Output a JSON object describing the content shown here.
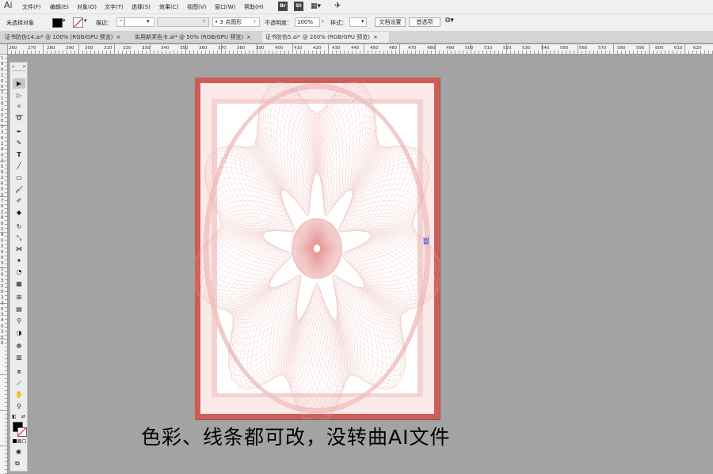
{
  "app": {
    "logo": "Ai",
    "menu": [
      "文件(F)",
      "编辑(E)",
      "对象(O)",
      "文字(T)",
      "选择(S)",
      "效果(C)",
      "视图(V)",
      "窗口(W)",
      "帮助(H)"
    ],
    "bridge_icon": "Br",
    "stock_icon": "St"
  },
  "control_bar": {
    "selection_status": "未选择对象",
    "stroke_label": "描边：",
    "brush_value": "3 点圆形",
    "opacity_label": "不透明度：",
    "opacity_value": "100%",
    "style_label": "样式：",
    "doc_setup_button": "文档设置",
    "preferences_button": "首选项"
  },
  "tabs": [
    {
      "label": "证书防伪14.ai* @ 100% (RGB/GPU 预览)",
      "close": "×",
      "active": false
    },
    {
      "label": "实用新奖色卡.ai* @ 50% (RGB/GPU 预览)",
      "close": "×",
      "active": false
    },
    {
      "label": "证书防伪5.ai* @ 200% (RGB/GPU 预览)",
      "close": "×",
      "active": true
    }
  ],
  "ruler": {
    "h_labels": [
      "260",
      "270",
      "280",
      "290",
      "300",
      "310",
      "320",
      "330",
      "340",
      "350",
      "360",
      "370",
      "380",
      "390",
      "400",
      "410",
      "420",
      "430",
      "440",
      "450",
      "460",
      "470",
      "480",
      "490",
      "500",
      "510",
      "520",
      "530",
      "540",
      "550",
      "560",
      "570",
      "580",
      "590",
      "600",
      "610",
      "620"
    ],
    "v_labels": [
      "1",
      "9",
      "0",
      "2",
      "0",
      "0",
      "2",
      "1",
      "0",
      "2",
      "2",
      "0",
      "2",
      "3",
      "0",
      "2",
      "4",
      "0",
      "2",
      "5",
      "0",
      "2",
      "6",
      "0",
      "2",
      "7",
      "0",
      "2",
      "8",
      "0",
      "2",
      "9",
      "0",
      "3",
      "0",
      "0",
      "3",
      "1",
      "0",
      "3",
      "2",
      "0",
      "3",
      "3",
      "0",
      "3",
      "4",
      "0",
      "3",
      "5",
      "0"
    ]
  },
  "canvas": {
    "artboard_color": "#cf5c55",
    "pattern_color": "#e8a8a8",
    "caption": "色彩、线条都可改，没转曲AI文件"
  },
  "tools": [
    "selection-tool",
    "direct-selection-tool",
    "magic-wand-tool",
    "lasso-tool",
    "pen-tool",
    "curvature-tool",
    "type-tool",
    "line-tool",
    "rectangle-tool",
    "paintbrush-tool",
    "shaper-tool",
    "eraser-tool",
    "rotate-tool",
    "scale-tool",
    "width-tool",
    "puppet-warp-tool",
    "shape-builder-tool",
    "perspective-grid-tool",
    "mesh-tool",
    "gradient-tool",
    "eyedropper-tool",
    "blend-tool",
    "symbol-sprayer-tool",
    "column-graph-tool",
    "artboard-tool",
    "slice-tool",
    "hand-tool",
    "zoom-tool"
  ]
}
